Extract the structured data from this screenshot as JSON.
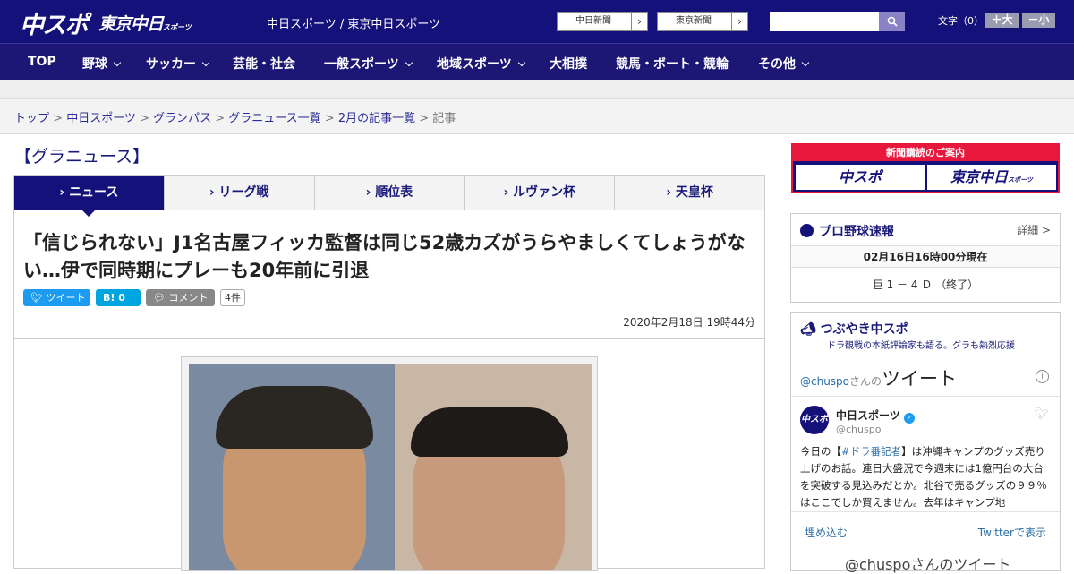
{
  "header": {
    "logo_chuspo": "中スポ",
    "logo_tokyo": "東京中日",
    "logo_tokyo_sub": "スポーツ",
    "sites_text": "中日スポーツ / 東京中日スポーツ",
    "btn_chunichi": "中日新聞",
    "btn_tokyo": "東京新聞",
    "font_label": "文字（0）",
    "font_up": "＋大",
    "font_down": "－小"
  },
  "nav": [
    "TOP",
    "野球",
    "サッカー",
    "芸能・社会",
    "一般スポーツ",
    "地域スポーツ",
    "大相撲",
    "競馬・ボート・競輪",
    "その他"
  ],
  "breadcrumb": {
    "items": [
      "トップ",
      "中日スポーツ",
      "グランパス",
      "グラニュース一覧",
      "2月の記事一覧"
    ],
    "current": "記事",
    "sep": " > "
  },
  "section_title": "【グラニュース】",
  "tabs": [
    "ニュース",
    "リーグ戦",
    "順位表",
    "ルヴァン杯",
    "天皇杯"
  ],
  "article": {
    "title": "「信じられない」J1名古屋フィッカ監督は同じ52歳カズがうらやましくてしょうがない…伊で同時期にプレーも20年前に引退",
    "tweet": "ツイート",
    "hatena": "B! 0",
    "comment": "コメント",
    "comment_count": "4件",
    "date": "2020年2月18日 19時44分"
  },
  "sidebar": {
    "ad_top": "新聞購読のご案内",
    "ad_left": "中スポ",
    "ad_right": "東京中日",
    "ad_right_sub": "スポーツ",
    "baseball_title": "プロ野球速報",
    "baseball_more": "詳細 >",
    "baseball_time": "02月16日16時00分現在",
    "baseball_score": "巨 1 － 4 Ｄ （終了）",
    "tsubuyaki_title": "つぶやき中スポ",
    "tsubuyaki_sub": "ドラ観戦の本紙評論家も語る。グラも熱烈応援",
    "tw_handle_pre": "@chuspo",
    "tw_handle_mid": "さんの",
    "tw_handle_big": "ツイート",
    "tw_name": "中日スポーツ",
    "tw_id": "@chuspo",
    "tw_text_1": "今日の【",
    "tw_hashtag": "#ドラ番記者",
    "tw_text_2": "】は沖縄キャンプのグッズ売り上げのお話。連日大盛況で今週末には1億円台の大台を突破する見込みだとか。北谷で売るグッズの９９％はここでしか買えません。去年はキャンプ地",
    "embed": "埋め込む",
    "view_on_twitter": "Twitterで表示",
    "tw_footer": "@chuspoさんのツイート"
  }
}
